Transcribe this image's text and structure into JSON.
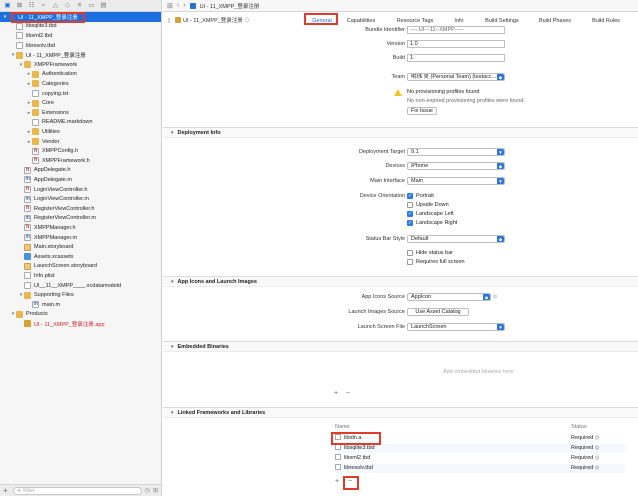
{
  "sidebar": {
    "toolbar_icons": [
      "folder-icon",
      "source-control-icon",
      "symbol-icon",
      "find-icon",
      "issue-icon",
      "test-icon",
      "debug-icon",
      "breakpoint-icon",
      "report-icon"
    ],
    "items": [
      {
        "label": "UI - 11_XMPP_登录注册",
        "level": 0,
        "icon": "project",
        "disclosure": "▾",
        "selected": true
      },
      {
        "label": "libsqlite3.tbd",
        "level": 1,
        "icon": "file"
      },
      {
        "label": "libxml2.tbd",
        "level": 1,
        "icon": "file"
      },
      {
        "label": "libresolv.tbd",
        "level": 1,
        "icon": "file"
      },
      {
        "label": "UI - 11_XMPP_登录注册",
        "level": 1,
        "icon": "folder",
        "disclosure": "▾"
      },
      {
        "label": "XMPPFramework",
        "level": 2,
        "icon": "folder",
        "disclosure": "▾"
      },
      {
        "label": "Authentication",
        "level": 3,
        "icon": "folder",
        "disclosure": "▸"
      },
      {
        "label": "Categories",
        "level": 3,
        "icon": "folder",
        "disclosure": "▸"
      },
      {
        "label": "copying.txt",
        "level": 3,
        "icon": "file"
      },
      {
        "label": "Core",
        "level": 3,
        "icon": "folder",
        "disclosure": "▸"
      },
      {
        "label": "Extensions",
        "level": 3,
        "icon": "folder",
        "disclosure": "▸"
      },
      {
        "label": "README.markdown",
        "level": 3,
        "icon": "file"
      },
      {
        "label": "Utilities",
        "level": 3,
        "icon": "folder",
        "disclosure": "▸"
      },
      {
        "label": "Vendor",
        "level": 3,
        "icon": "folder",
        "disclosure": "▸"
      },
      {
        "label": "XMPPConfig.h",
        "level": 3,
        "icon": "h"
      },
      {
        "label": "XMPPFramework.h",
        "level": 3,
        "icon": "h"
      },
      {
        "label": "AppDelegate.h",
        "level": 2,
        "icon": "h"
      },
      {
        "label": "AppDelegate.m",
        "level": 2,
        "icon": "m"
      },
      {
        "label": "LoginViewController.h",
        "level": 2,
        "icon": "h"
      },
      {
        "label": "LoginViewController.m",
        "level": 2,
        "icon": "m"
      },
      {
        "label": "RegisterViewController.h",
        "level": 2,
        "icon": "h"
      },
      {
        "label": "RegisterViewController.m",
        "level": 2,
        "icon": "m"
      },
      {
        "label": "XMPPManager.h",
        "level": 2,
        "icon": "h"
      },
      {
        "label": "XMPPManager.m",
        "level": 2,
        "icon": "m"
      },
      {
        "label": "Main.storyboard",
        "level": 2,
        "icon": "storyboard"
      },
      {
        "label": "Assets.xcassets",
        "level": 2,
        "icon": "assets"
      },
      {
        "label": "LaunchScreen.storyboard",
        "level": 2,
        "icon": "storyboard"
      },
      {
        "label": "Info.plist",
        "level": 2,
        "icon": "file"
      },
      {
        "label": "UI__11__XMPP____.xcdatamodeld",
        "level": 2,
        "icon": "model"
      },
      {
        "label": "Supporting Files",
        "level": 2,
        "icon": "folder",
        "disclosure": "▾"
      },
      {
        "label": "main.m",
        "level": 3,
        "icon": "m"
      },
      {
        "label": "Products",
        "level": 1,
        "icon": "folder",
        "disclosure": "▾"
      },
      {
        "label": "UI - 11_XMPP_登录注册.app",
        "level": 2,
        "icon": "app",
        "red": true
      }
    ],
    "filter_placeholder": "Filter",
    "add_symbol": "+"
  },
  "jumpbar": {
    "project": "UI - 11_XMPP_登录注册"
  },
  "tabs": [
    "General",
    "Capabilities",
    "Resource Tags",
    "Info",
    "Build Settings",
    "Build Phases",
    "Build Rules"
  ],
  "identity": {
    "bundle_identifier_label": "Bundle Identifier",
    "bundle_identifier_value": "----.UI---11--XMPP-----",
    "version_label": "Version",
    "version_value": "1.0",
    "build_label": "Build",
    "build_value": "1"
  },
  "signing": {
    "team_label": "Team",
    "team_value": "明玮 吴 (Personal Team) (testacc...",
    "warning_title": "No provisioning profiles found",
    "warning_detail": "No non-expired provisioning profiles were found.",
    "fix_button": "Fix Issue"
  },
  "deployment": {
    "header": "Deployment Info",
    "target_label": "Deployment Target",
    "target_value": "9.1",
    "devices_label": "Devices",
    "devices_value": "iPhone",
    "main_interface_label": "Main Interface",
    "main_interface_value": "Main",
    "orientation_label": "Device Orientation",
    "orientations": [
      {
        "label": "Portrait",
        "checked": true
      },
      {
        "label": "Upside Down",
        "checked": false
      },
      {
        "label": "Landscape Left",
        "checked": true
      },
      {
        "label": "Landscape Right",
        "checked": true
      }
    ],
    "status_bar_label": "Status Bar Style",
    "status_bar_value": "Default",
    "status_options": [
      {
        "label": "Hide status bar",
        "checked": false
      },
      {
        "label": "Requires full screen",
        "checked": false
      }
    ]
  },
  "app_icons": {
    "header": "App Icons and Launch Images",
    "icons_source_label": "App Icons Source",
    "icons_source_value": "AppIcon",
    "launch_images_label": "Launch Images Source",
    "launch_images_button": "Use Asset Catalog",
    "launch_screen_label": "Launch Screen File",
    "launch_screen_value": "LaunchScreen"
  },
  "embedded": {
    "header": "Embedded Binaries",
    "placeholder": "Add embedded binaries here",
    "add_symbol": "+",
    "remove_symbol": "−"
  },
  "linked": {
    "header": "Linked Frameworks and Libraries",
    "name_col": "Name",
    "status_col": "Status",
    "rows": [
      {
        "name": "libidn.a",
        "status": "Required ◇"
      },
      {
        "name": "libsqlite3.tbd",
        "status": "Required ◇"
      },
      {
        "name": "libxml2.tbd",
        "status": "Required ◇"
      },
      {
        "name": "libresolv.tbd",
        "status": "Required ◇"
      }
    ],
    "add_symbol": "+",
    "remove_symbol": "−"
  }
}
